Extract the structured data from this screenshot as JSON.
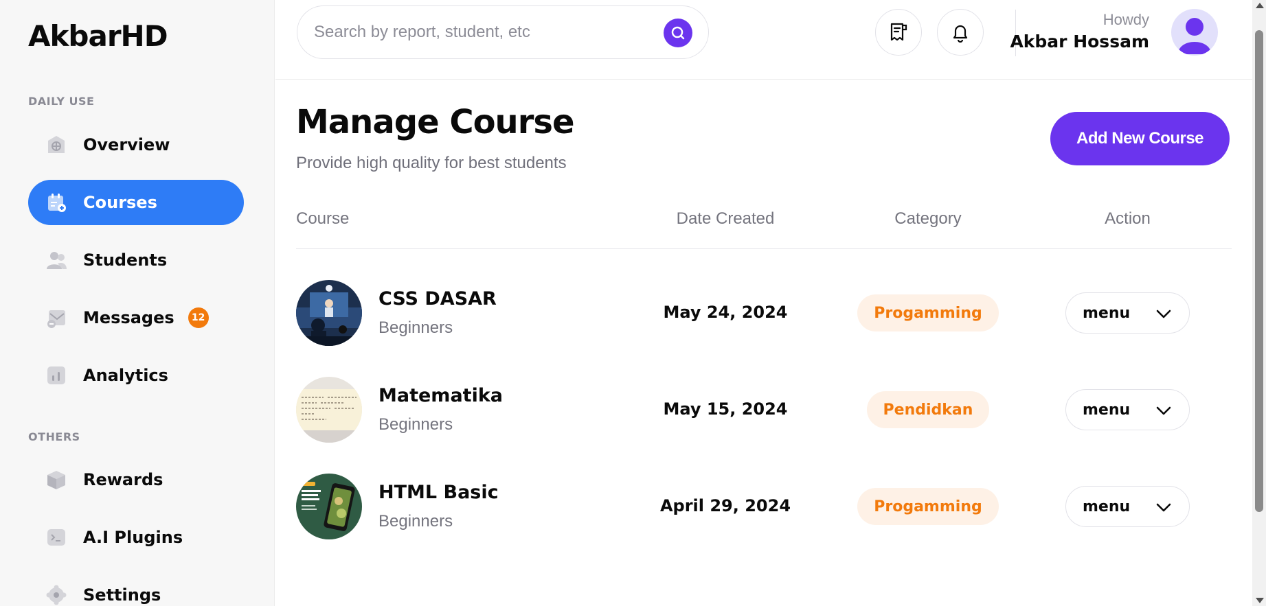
{
  "brand": "AkbarHD",
  "sidebar": {
    "section_daily": "DAILY USE",
    "section_others": "OTHERS",
    "items": [
      {
        "label": "Overview",
        "icon": "overview-icon"
      },
      {
        "label": "Courses",
        "icon": "calendar-add-icon",
        "active": true
      },
      {
        "label": "Students",
        "icon": "users-icon"
      },
      {
        "label": "Messages",
        "icon": "mail-icon",
        "badge": "12"
      },
      {
        "label": "Analytics",
        "icon": "bar-chart-icon"
      },
      {
        "label": "Rewards",
        "icon": "box-icon"
      },
      {
        "label": "A.I Plugins",
        "icon": "terminal-icon"
      },
      {
        "label": "Settings",
        "icon": "gear-icon"
      }
    ]
  },
  "topbar": {
    "search_placeholder": "Search by report, student, etc",
    "greeting": "Howdy",
    "username": "Akbar Hossam"
  },
  "page": {
    "title": "Manage Course",
    "subtitle": "Provide high quality for best students",
    "add_button": "Add New Course"
  },
  "table": {
    "headers": [
      "Course",
      "Date Created",
      "Category",
      "Action"
    ],
    "rows": [
      {
        "name": "CSS DASAR",
        "level": "Beginners",
        "date": "May 24, 2024",
        "category": "Progamming",
        "action": "menu"
      },
      {
        "name": "Matematika",
        "level": "Beginners",
        "date": "May 15, 2024",
        "category": "Pendidkan",
        "action": "menu"
      },
      {
        "name": "HTML Basic",
        "level": "Beginners",
        "date": "April 29, 2024",
        "category": "Progamming",
        "action": "menu"
      }
    ]
  },
  "colors": {
    "accent_purple": "#6b34ee",
    "active_blue": "#2e7cf6",
    "badge_orange": "#f27a0c",
    "category_bg": "#fef1e6"
  }
}
